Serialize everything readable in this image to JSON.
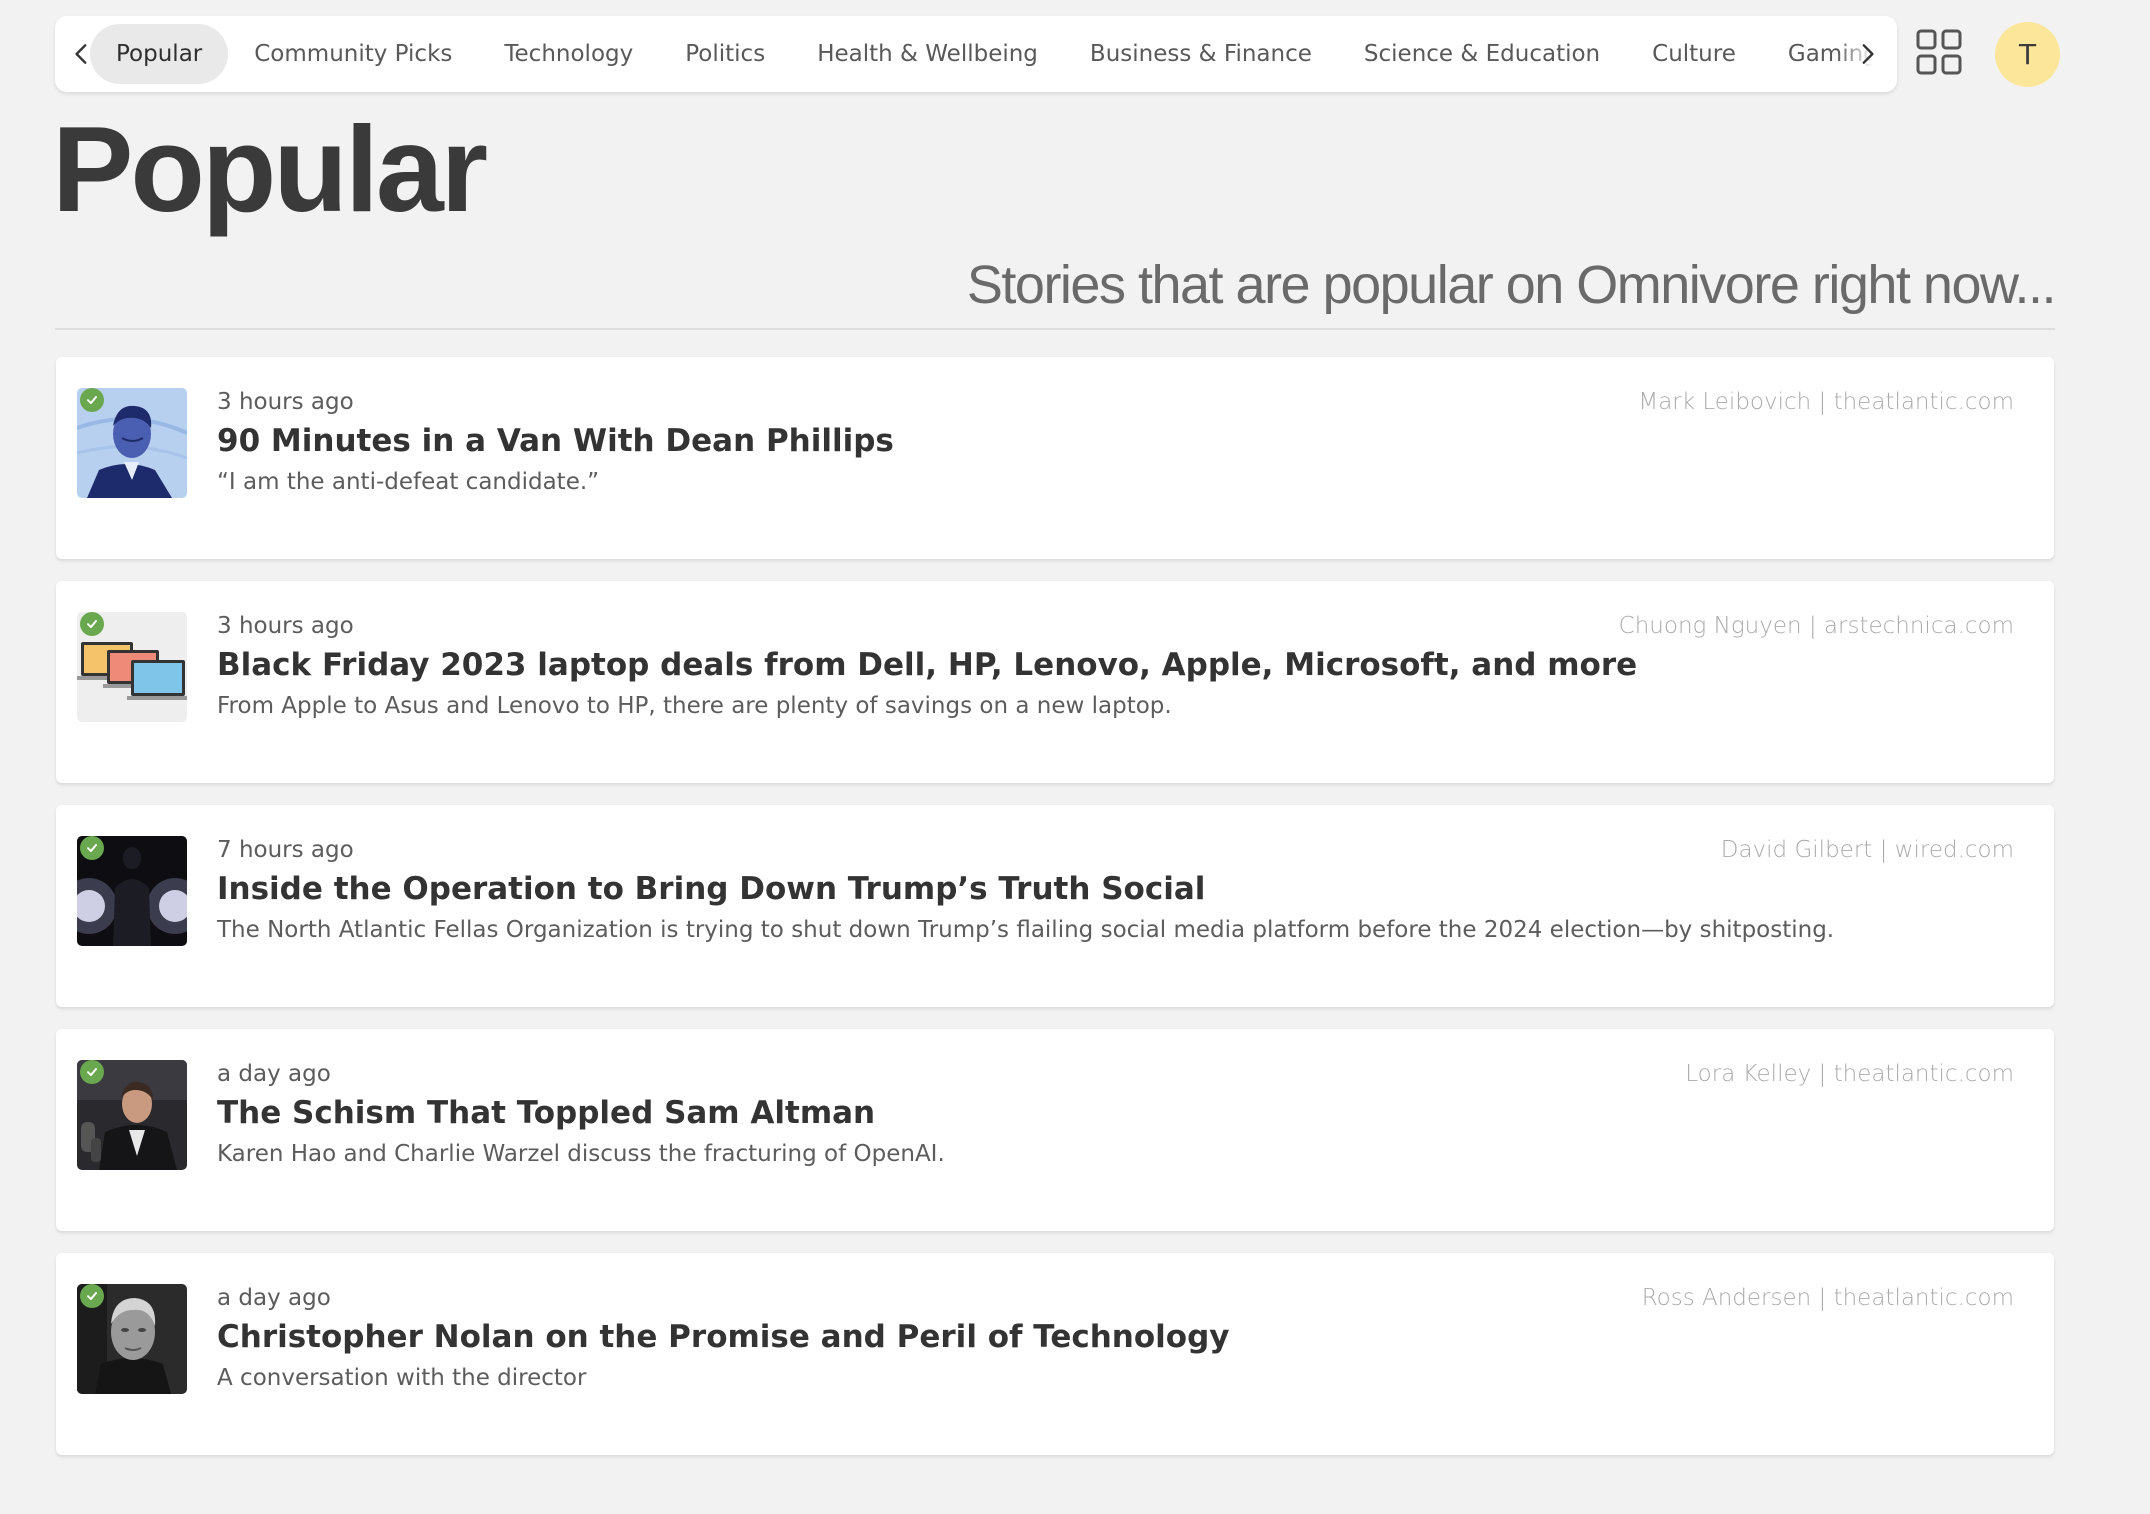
{
  "nav": {
    "tabs": [
      {
        "label": "Popular",
        "active": true
      },
      {
        "label": "Community Picks",
        "active": false
      },
      {
        "label": "Technology",
        "active": false
      },
      {
        "label": "Politics",
        "active": false
      },
      {
        "label": "Health & Wellbeing",
        "active": false
      },
      {
        "label": "Business & Finance",
        "active": false
      },
      {
        "label": "Science & Education",
        "active": false
      },
      {
        "label": "Culture",
        "active": false
      },
      {
        "label": "Gaming",
        "active": false
      }
    ],
    "left_icon": "chevron-left-icon",
    "right_icon": "chevron-right-icon",
    "grid_icon": "grid-icon"
  },
  "user": {
    "avatar_letter": "T",
    "avatar_color": "#fce69a"
  },
  "page": {
    "title": "Popular",
    "subtitle": "Stories that are popular on Omnivore right now..."
  },
  "stories": [
    {
      "time": "3 hours ago",
      "title": "90 Minutes in a Van With Dean Phillips",
      "description": "“I am the anti-defeat candidate.”",
      "byline": "Mark Leibovich | theatlantic.com",
      "thumb": "portrait-illustration",
      "saved": true
    },
    {
      "time": "3 hours ago",
      "title": "Black Friday 2023 laptop deals from Dell, HP, Lenovo, Apple, Microsoft, and more",
      "description": "From Apple to Asus and Lenovo to HP, there are plenty of savings on a new laptop.",
      "byline": "Chuong Nguyen | arstechnica.com",
      "thumb": "laptops",
      "saved": true
    },
    {
      "time": "7 hours ago",
      "title": "Inside the Operation to Bring Down Trump’s Truth Social",
      "description": "The North Atlantic Fellas Organization is trying to shut down Trump’s flailing social media platform before the 2024 election—by shitposting.",
      "byline": "David Gilbert | wired.com",
      "thumb": "silhouette-lights",
      "saved": true
    },
    {
      "time": "a day ago",
      "title": "The Schism That Toppled Sam Altman",
      "description": "Karen Hao and Charlie Warzel discuss the fracturing of OpenAI.",
      "byline": "Lora Kelley | theatlantic.com",
      "thumb": "speaker-photo",
      "saved": true
    },
    {
      "time": "a day ago",
      "title": "Christopher Nolan on the Promise and Peril of Technology",
      "description": "A conversation with the director",
      "byline": "Ross Andersen | theatlantic.com",
      "thumb": "bw-portrait",
      "saved": true
    }
  ],
  "colors": {
    "background": "#f2f2f2",
    "card": "#ffffff",
    "saved_check": "#6aa84f",
    "active_tab": "#e9e9e9"
  }
}
